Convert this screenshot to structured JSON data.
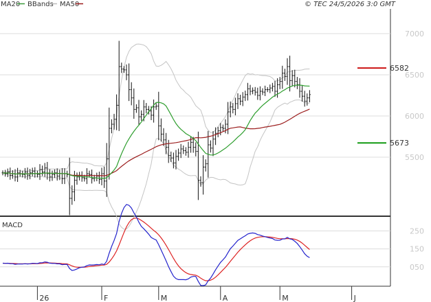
{
  "header": {
    "legend": [
      {
        "label": "MA20",
        "color": "#3a9a3a"
      },
      {
        "label": "BBands",
        "color": "#bdbdbd"
      },
      {
        "label": "MA50",
        "color": "#9b1c1c"
      }
    ],
    "copyright": "© TEC 24/5/2026 3:0 GMT"
  },
  "chart_data": [
    {
      "type": "ohlc",
      "panel": "price",
      "y_ticks": [
        "7000",
        "6500",
        "6000",
        "5500"
      ],
      "y_ticks_values": [
        7000,
        6500,
        6000,
        5500
      ],
      "ylim": [
        4800,
        7300
      ],
      "levels": [
        {
          "value": 6582,
          "label": "6582",
          "color": "#cc1111"
        },
        {
          "value": 5673,
          "label": "5673",
          "color": "#119911"
        }
      ],
      "close": [
        5310,
        5300,
        5320,
        5280,
        5300,
        5260,
        5310,
        5300,
        5290,
        5320,
        5280,
        5310,
        5330,
        5300,
        5290,
        5350,
        5320,
        5370,
        5300,
        5260,
        5290,
        5310,
        5270,
        5300,
        5240,
        5300,
        5290,
        5000,
        5080,
        5220,
        5260,
        5280,
        5250,
        5240,
        5300,
        5290,
        5240,
        5250,
        5270,
        5230,
        5300,
        5210,
        5480,
        5850,
        5900,
        5960,
        6130,
        6600,
        6570,
        6560,
        6500,
        6320,
        6220,
        6080,
        6100,
        5990,
        6020,
        6110,
        6080,
        6060,
        6010,
        6110,
        6120,
        5880,
        5780,
        5710,
        5620,
        5520,
        5490,
        5430,
        5510,
        5550,
        5600,
        5580,
        5560,
        5620,
        5680,
        5620,
        5570,
        5220,
        5190,
        5380,
        5420,
        5650,
        5610,
        5720,
        5790,
        5820,
        5860,
        5850,
        5900,
        6050,
        6110,
        6080,
        6150,
        6210,
        6180,
        6230,
        6260,
        6330,
        6300,
        6310,
        6290,
        6250,
        6300,
        6290,
        6320,
        6320,
        6340,
        6360,
        6300,
        6380,
        6420,
        6520,
        6480,
        6600,
        6430,
        6490,
        6420,
        6380,
        6300,
        6240,
        6180,
        6220,
        6260
      ]
    },
    {
      "type": "line",
      "panel": "macd",
      "title": "MACD",
      "y_ticks": [
        "250",
        "150",
        "050"
      ],
      "y_ticks_values": [
        250,
        150,
        50
      ],
      "ylim": [
        -50,
        320
      ],
      "series": [
        {
          "key": "macd",
          "color": "#2222cc"
        },
        {
          "key": "signal",
          "color": "#dd2222"
        }
      ]
    }
  ],
  "x_axis": {
    "ticks": [
      {
        "label": "26",
        "index": 14
      },
      {
        "label": "F",
        "index": 40
      },
      {
        "label": "M",
        "index": 63
      },
      {
        "label": "A",
        "index": 88
      },
      {
        "label": "M",
        "index": 112
      },
      {
        "label": "J",
        "index": 141
      }
    ]
  }
}
